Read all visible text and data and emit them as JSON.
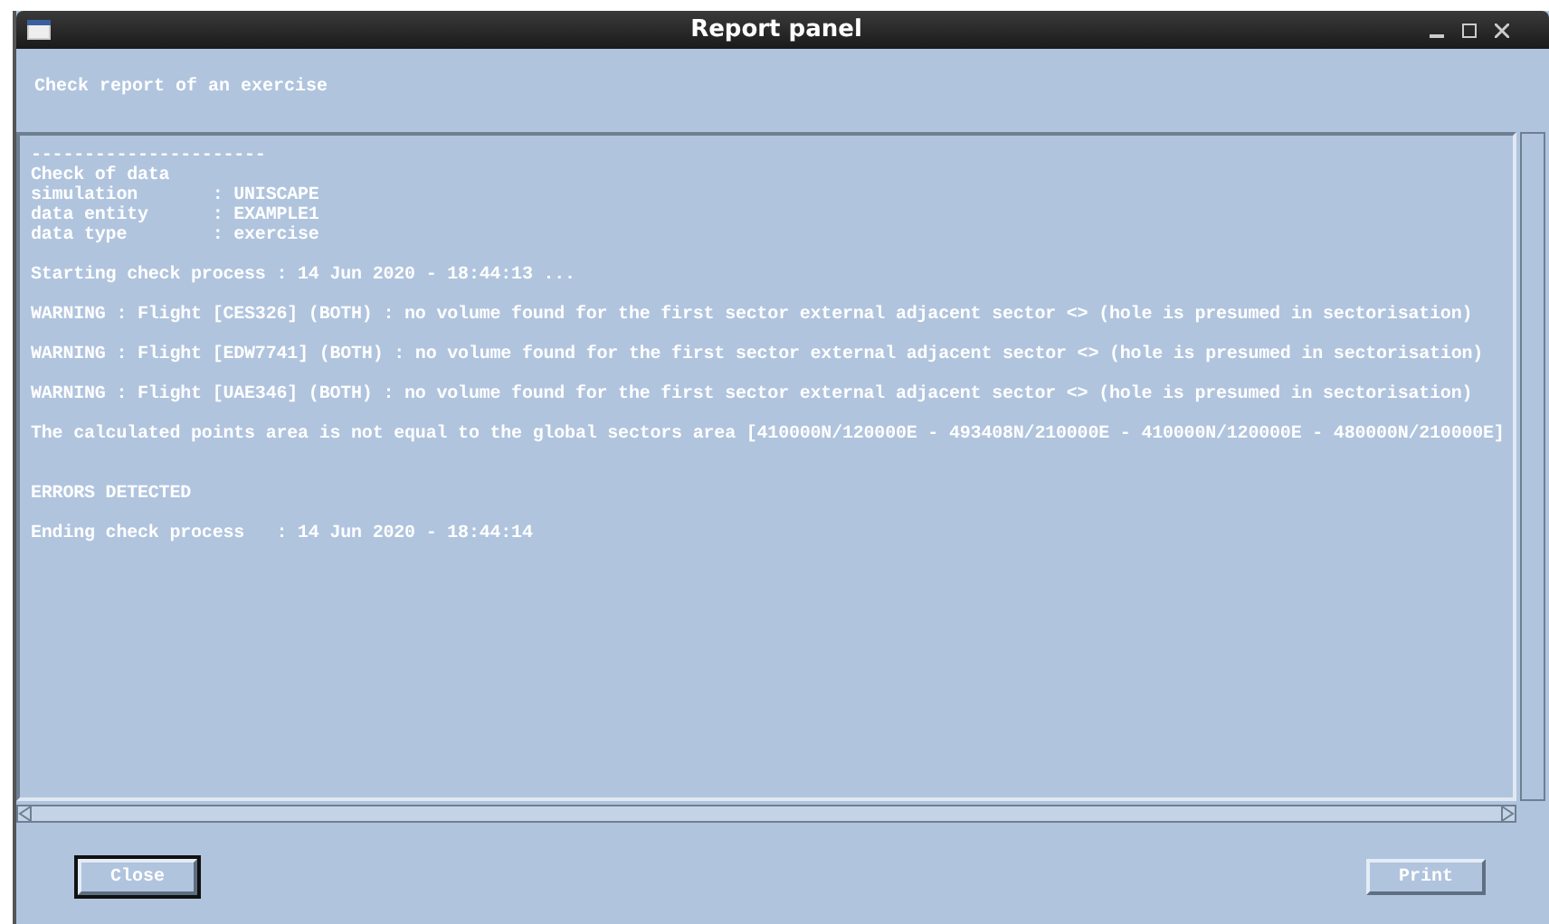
{
  "window": {
    "title": "Report panel"
  },
  "heading": "Check report of an exercise",
  "report": [
    {
      "kind": "line",
      "lines": [
        "----------------------",
        "Check of data",
        "simulation       : UNISCAPE",
        "data entity      : EXAMPLE1",
        "data type        : exercise"
      ]
    },
    {
      "kind": "line",
      "lines": [
        "Starting check process : 14 Jun 2020 - 18:44:13 ..."
      ]
    },
    {
      "kind": "line",
      "lines": [
        "WARNING : Flight [CES326] (BOTH) : no volume found for the first sector external adjacent sector <> (hole is presumed in sectorisation)"
      ]
    },
    {
      "kind": "line",
      "lines": [
        "WARNING : Flight [EDW7741] (BOTH) : no volume found for the first sector external adjacent sector <> (hole is presumed in sectorisation)"
      ]
    },
    {
      "kind": "line",
      "lines": [
        "WARNING : Flight [UAE346] (BOTH) : no volume found for the first sector external adjacent sector <> (hole is presumed in sectorisation)"
      ]
    },
    {
      "kind": "line",
      "lines": [
        "The calculated points area is not equal to the global sectors area [410000N/120000E - 493408N/210000E - 410000N/120000E - 480000N/210000E]"
      ]
    },
    {
      "kind": "section",
      "lines": [
        "ERRORS DETECTED"
      ]
    },
    {
      "kind": "line",
      "lines": [
        "Ending check process   : 14 Jun 2020 - 18:44:14"
      ]
    }
  ],
  "buttons": [
    {
      "label": "Close",
      "focused": true
    },
    {
      "label": "Print",
      "focused": false
    }
  ]
}
